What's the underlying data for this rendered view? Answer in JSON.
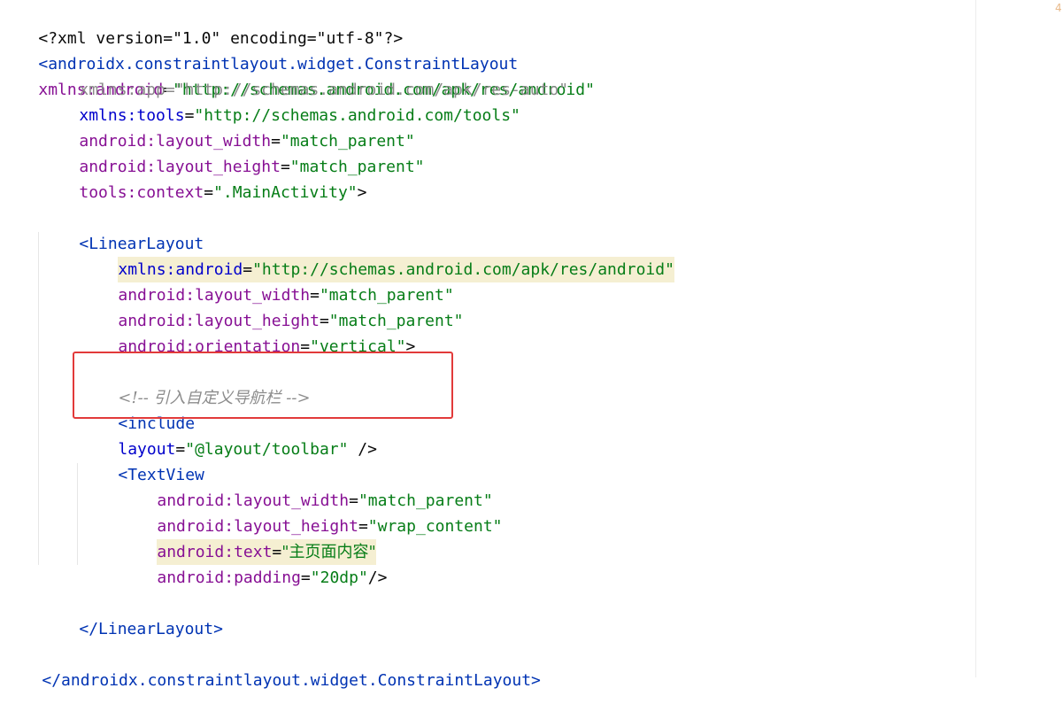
{
  "editor": {
    "lines": [
      {
        "text": "<?xml version=\"1.0\" encoding=\"utf-8\"?>"
      },
      {
        "tag_open": "<androidx.constraintlayout.widget.ConstraintLayout",
        "attr_ns": "xmlns:android",
        "value": "\"http://schemas.android.com/apk/res/android\""
      },
      {
        "attr": "xmlns:app",
        "value": "\"http://schemas.android.com/apk/res-auto\""
      },
      {
        "attr_ns": "xmlns:tools",
        "value": "\"http://schemas.android.com/tools\""
      },
      {
        "ns": "android",
        "attr": "layout_width",
        "value": "\"match_parent\""
      },
      {
        "ns": "android",
        "attr": "layout_height",
        "value": "\"match_parent\""
      },
      {
        "ns": "tools",
        "attr": "context",
        "value": "\".MainActivity\"",
        "close": ">"
      },
      {
        "tag_open": "<LinearLayout"
      },
      {
        "attr_ns": "xmlns:android",
        "value": "\"http://schemas.android.com/apk/res/android\""
      },
      {
        "ns": "android",
        "attr": "layout_width",
        "value": "\"match_parent\""
      },
      {
        "ns": "android",
        "attr": "layout_height",
        "value": "\"match_parent\""
      },
      {
        "ns": "android",
        "attr": "orientation",
        "value": "\"vertical\"",
        "close": ">"
      },
      {
        "comment": "<!-- 引入自定义导航栏 -->"
      },
      {
        "tag_open": "<include",
        "attr": "layout",
        "value": "\"@layout/toolbar\"",
        "close": " />"
      },
      {
        "tag_open": "<TextView"
      },
      {
        "ns": "android",
        "attr": "layout_width",
        "value": "\"match_parent\""
      },
      {
        "ns": "android",
        "attr": "layout_height",
        "value": "\"wrap_content\""
      },
      {
        "ns": "android",
        "attr": "text",
        "value": "\"主页面内容\""
      },
      {
        "ns": "android",
        "attr": "padding",
        "value": "\"20dp\"",
        "close": "/>"
      },
      {
        "tag_close": "</LinearLayout>"
      },
      {
        "tag_close": "</androidx.constraintlayout.widget.ConstraintLayout>"
      }
    ],
    "corner_mark": "4"
  },
  "colors": {
    "tag": "#0033b3",
    "attribute": "#871094",
    "value": "#067d17",
    "comment": "#8c8c8c",
    "highlight": "#f5efd2",
    "annotation_box": "#e23a3a"
  }
}
